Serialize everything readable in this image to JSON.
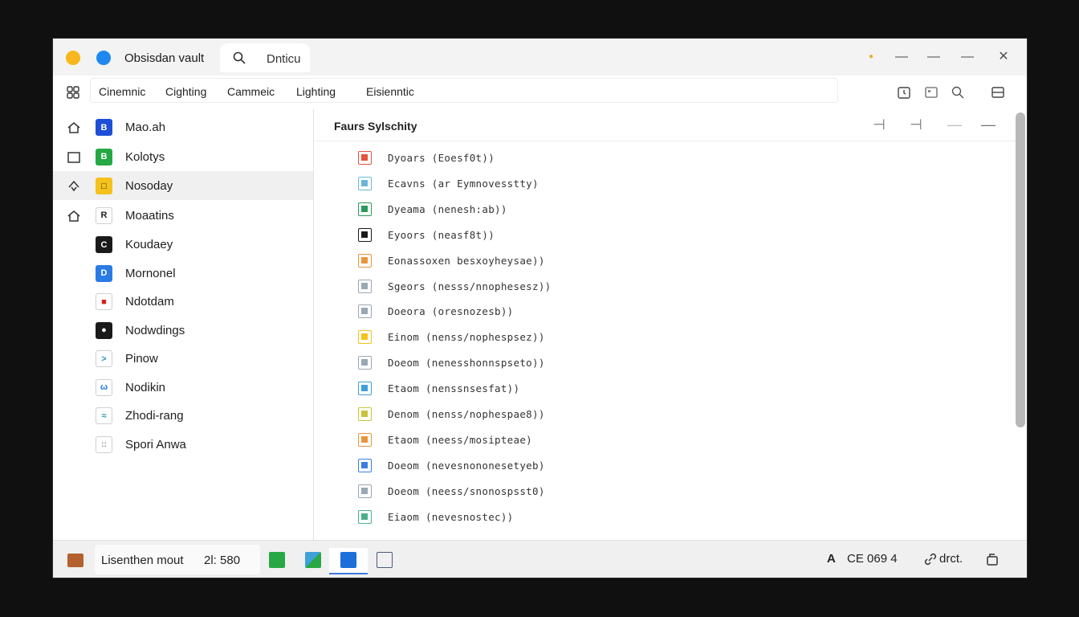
{
  "window": {
    "title": "Obsisdan vault",
    "tab_label": "Dnticu"
  },
  "toolbar": {
    "menu": [
      "Cinemnic",
      "Cighting",
      "Cammeic",
      "Lighting",
      "Eisienntic"
    ]
  },
  "sidebar": {
    "items": [
      {
        "label": "Mao.ah",
        "lead_icon": "home-icon",
        "badge_color": "#1e4fd6",
        "badge_text": "B",
        "badge_fg": "#ffffff"
      },
      {
        "label": "Kolotys",
        "lead_icon": "square-icon",
        "badge_color": "#27a845",
        "badge_text": "B",
        "badge_fg": "#ffffff"
      },
      {
        "label": "Nosoday",
        "lead_icon": "recycle-icon",
        "badge_color": "#f4c21b",
        "badge_text": "□",
        "badge_fg": "#222222",
        "active": true
      },
      {
        "label": "Moaatins",
        "lead_icon": "home-icon",
        "badge_color": "#ffffff",
        "badge_text": "R",
        "badge_fg": "#222222"
      },
      {
        "label": "Koudaey",
        "badge_color": "#1a1a1a",
        "badge_text": "C",
        "badge_fg": "#ffffff"
      },
      {
        "label": "Mornonel",
        "badge_color": "#2a7be4",
        "badge_text": "D",
        "badge_fg": "#ffffff"
      },
      {
        "label": "Ndotdam",
        "badge_color": "#ffffff",
        "badge_text": "■",
        "badge_fg": "#d62020"
      },
      {
        "label": "Nodwdings",
        "badge_color": "#1a1a1a",
        "badge_text": "●",
        "badge_fg": "#ffffff"
      },
      {
        "label": "Pinow",
        "badge_color": "#ffffff",
        "badge_text": ">",
        "badge_fg": "#2b8fc7"
      },
      {
        "label": "Nodikin",
        "badge_color": "#ffffff",
        "badge_text": "ω",
        "badge_fg": "#2a7be4"
      },
      {
        "label": "Zhodi-rang",
        "badge_color": "#ffffff",
        "badge_text": "≈",
        "badge_fg": "#2a9ab8"
      },
      {
        "label": "Spori Anwa",
        "badge_color": "#ffffff",
        "badge_text": "::",
        "badge_fg": "#999999"
      }
    ]
  },
  "main": {
    "title": "Faurs Sylschity",
    "files": [
      {
        "name": "Dyoars (Eoesf0t))",
        "icon_color": "#e5533d"
      },
      {
        "name": "Ecavns (ar Eymnovesstty)",
        "icon_color": "#6bb8d6"
      },
      {
        "name": "Dyeama (nenesh:ab))",
        "icon_color": "#2a9a5c"
      },
      {
        "name": "Eyoors (neasf8t))",
        "icon_color": "#1a1a1a"
      },
      {
        "name": "Eonassoxen besxoyheysae))",
        "icon_color": "#e8963a"
      },
      {
        "name": "Sgeors (nesss/nnophesesz))",
        "icon_color": "#9aa7b4"
      },
      {
        "name": "Doeora (oresnozesb))",
        "icon_color": "#9aa7b4"
      },
      {
        "name": "Einom (nenss/nophespsez))",
        "icon_color": "#f4c21b"
      },
      {
        "name": "Doeom (nenesshonnspseto))",
        "icon_color": "#9aa7b4"
      },
      {
        "name": "Etaom (nenssnsesfat))",
        "icon_color": "#3fa0d8"
      },
      {
        "name": "Denom (nenss/nophespae8))",
        "icon_color": "#c8c43a"
      },
      {
        "name": "Etaom (neess/mosipteae)",
        "icon_color": "#e8963a"
      },
      {
        "name": "Doeom (nevesnononesetyeb)",
        "icon_color": "#3a7fe0"
      },
      {
        "name": "Doeom (neess/snonospsst0)",
        "icon_color": "#9aa7b4"
      },
      {
        "name": "Eiaom (nevesnostec))",
        "icon_color": "#4ab08a"
      }
    ]
  },
  "statusbar": {
    "text_value": "Lisenthen mout",
    "numbers": "2l: 580",
    "tray_a": "A",
    "tray_code": "CE 069 4",
    "tray_label": "drct."
  }
}
